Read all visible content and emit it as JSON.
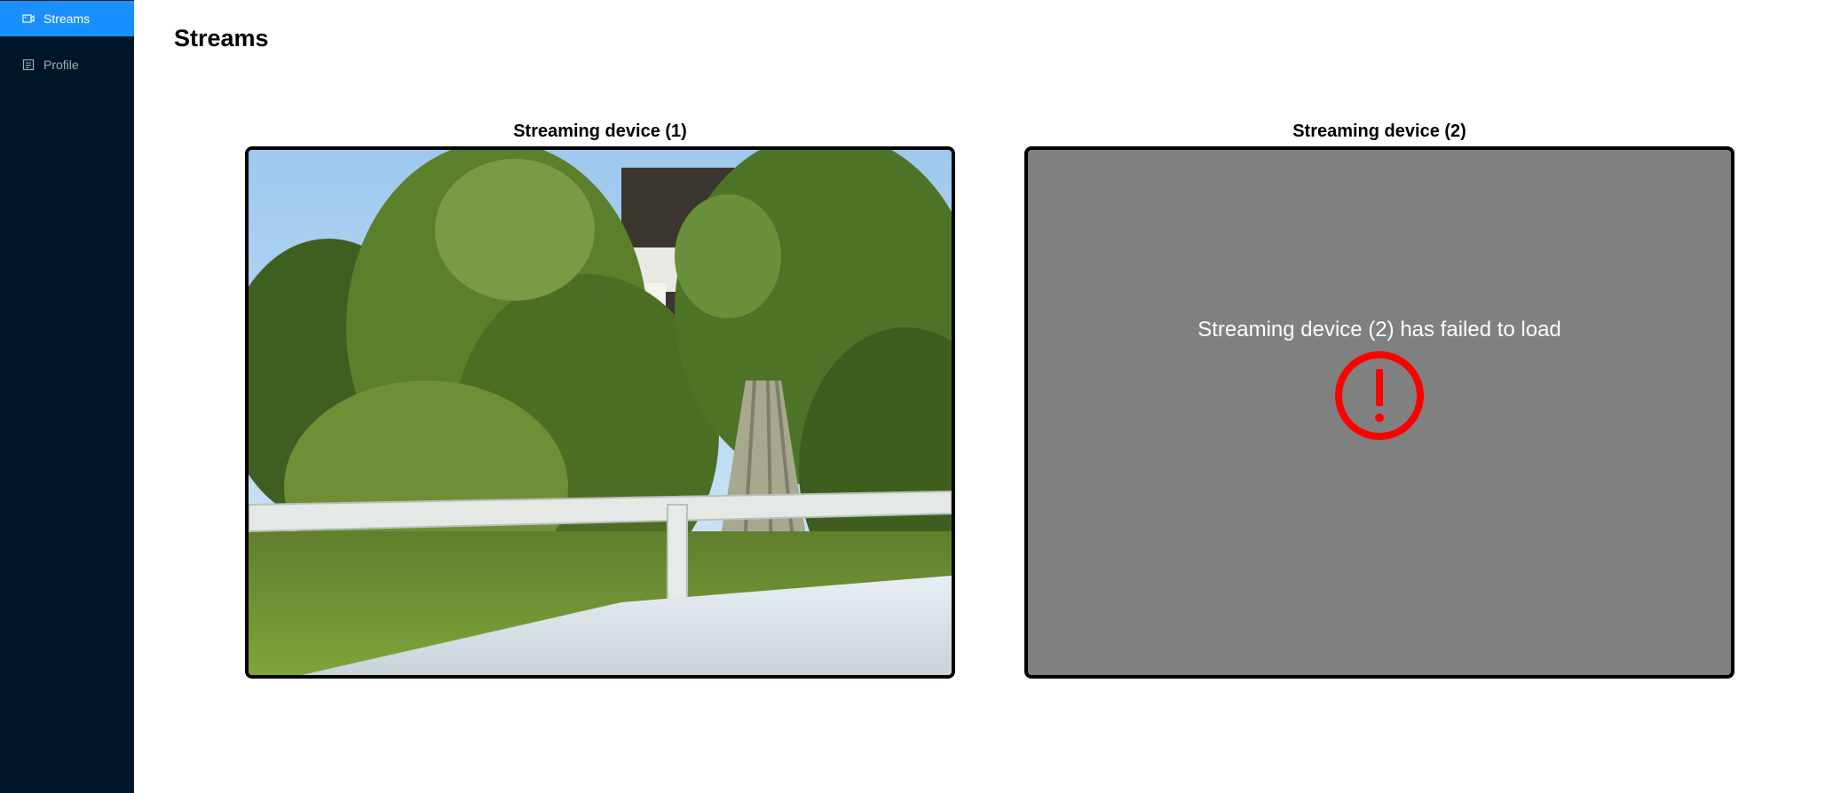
{
  "sidebar": {
    "items": [
      {
        "label": "Streams",
        "icon": "video-camera-icon",
        "active": true
      },
      {
        "label": "Profile",
        "icon": "profile-icon",
        "active": false
      }
    ],
    "background": "#001529",
    "active_color": "#1890ff"
  },
  "page": {
    "title": "Streams"
  },
  "devices": [
    {
      "title": "Streaming device (1)",
      "status": "live"
    },
    {
      "title": "Streaming device (2)",
      "status": "failed",
      "error_message": "Streaming device (2) has failed to load",
      "error_icon": "exclamation-circle-icon",
      "error_color": "#ff0000"
    }
  ]
}
